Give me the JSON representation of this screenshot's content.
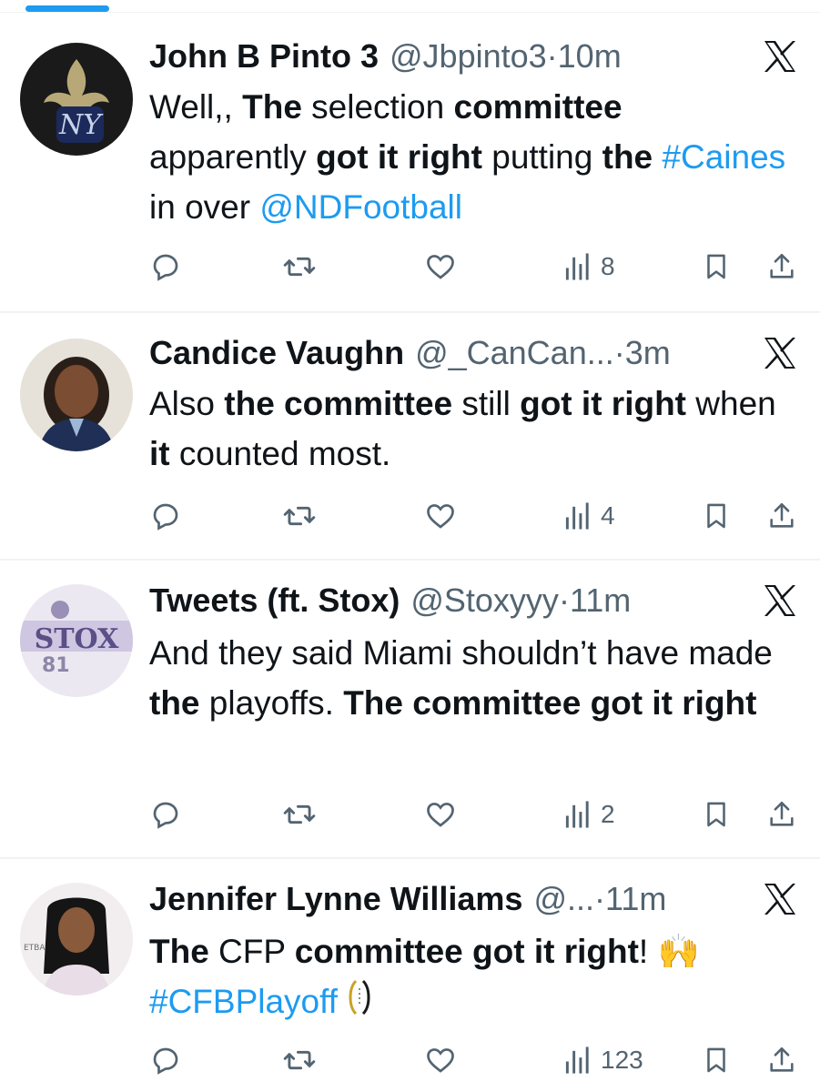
{
  "tweets": [
    {
      "name": "John B Pinto 3",
      "handle": "@Jbpinto3",
      "sep": "·",
      "time": "10m",
      "text_segments": [
        {
          "t": "Well,, ",
          "s": "n"
        },
        {
          "t": "The",
          "s": "b"
        },
        {
          "t": " selection ",
          "s": "n"
        },
        {
          "t": "committee",
          "s": "b"
        },
        {
          "t": " apparently ",
          "s": "n"
        },
        {
          "t": "got it right",
          "s": "b"
        },
        {
          "t": " putting ",
          "s": "n"
        },
        {
          "t": "the",
          "s": "b"
        },
        {
          "t": " ",
          "s": "n"
        },
        {
          "t": "#Caines",
          "s": "l"
        },
        {
          "t": " in over ",
          "s": "n"
        },
        {
          "t": "@NDFootball",
          "s": "l"
        }
      ],
      "views": "8"
    },
    {
      "name": "Candice Vaughn",
      "handle": "@_CanCan...",
      "sep": "·",
      "time": "3m",
      "text_segments": [
        {
          "t": "Also ",
          "s": "n"
        },
        {
          "t": "the committee",
          "s": "b"
        },
        {
          "t": " still ",
          "s": "n"
        },
        {
          "t": "got it right",
          "s": "b"
        },
        {
          "t": " when ",
          "s": "n"
        },
        {
          "t": "it",
          "s": "b"
        },
        {
          "t": " counted most.",
          "s": "n"
        }
      ],
      "views": "4"
    },
    {
      "name": "Tweets (ft. Stox)",
      "handle": "@Stoxyyy",
      "sep": "·",
      "time": "11m",
      "avatar_text": "STOX",
      "text_segments": [
        {
          "t": "And they said Miami shouldn’t have made ",
          "s": "n"
        },
        {
          "t": "the",
          "s": "b"
        },
        {
          "t": " playoffs. ",
          "s": "n"
        },
        {
          "t": "The committee got it right",
          "s": "b"
        }
      ],
      "views": "2"
    },
    {
      "name": "Jennifer Lynne Williams",
      "handle": "@...",
      "sep": "·",
      "time": "11m",
      "text_segments": [
        {
          "t": "The",
          "s": "b"
        },
        {
          "t": " CFP ",
          "s": "n"
        },
        {
          "t": "committee got it right",
          "s": "b"
        },
        {
          "t": "! 🙌 ",
          "s": "n"
        },
        {
          "t": "#CFBPlayoff",
          "s": "l"
        },
        {
          "t": " ",
          "s": "n"
        }
      ],
      "views": "123"
    }
  ],
  "colors": {
    "link": "#1d9bf0",
    "muted": "#536471",
    "text": "#0f1419",
    "divider": "#eff3f4"
  },
  "icons": [
    "reply-icon",
    "retweet-icon",
    "like-icon",
    "views-icon",
    "bookmark-icon",
    "share-icon",
    "x-logo-icon",
    "cfp-trophy-icon"
  ]
}
